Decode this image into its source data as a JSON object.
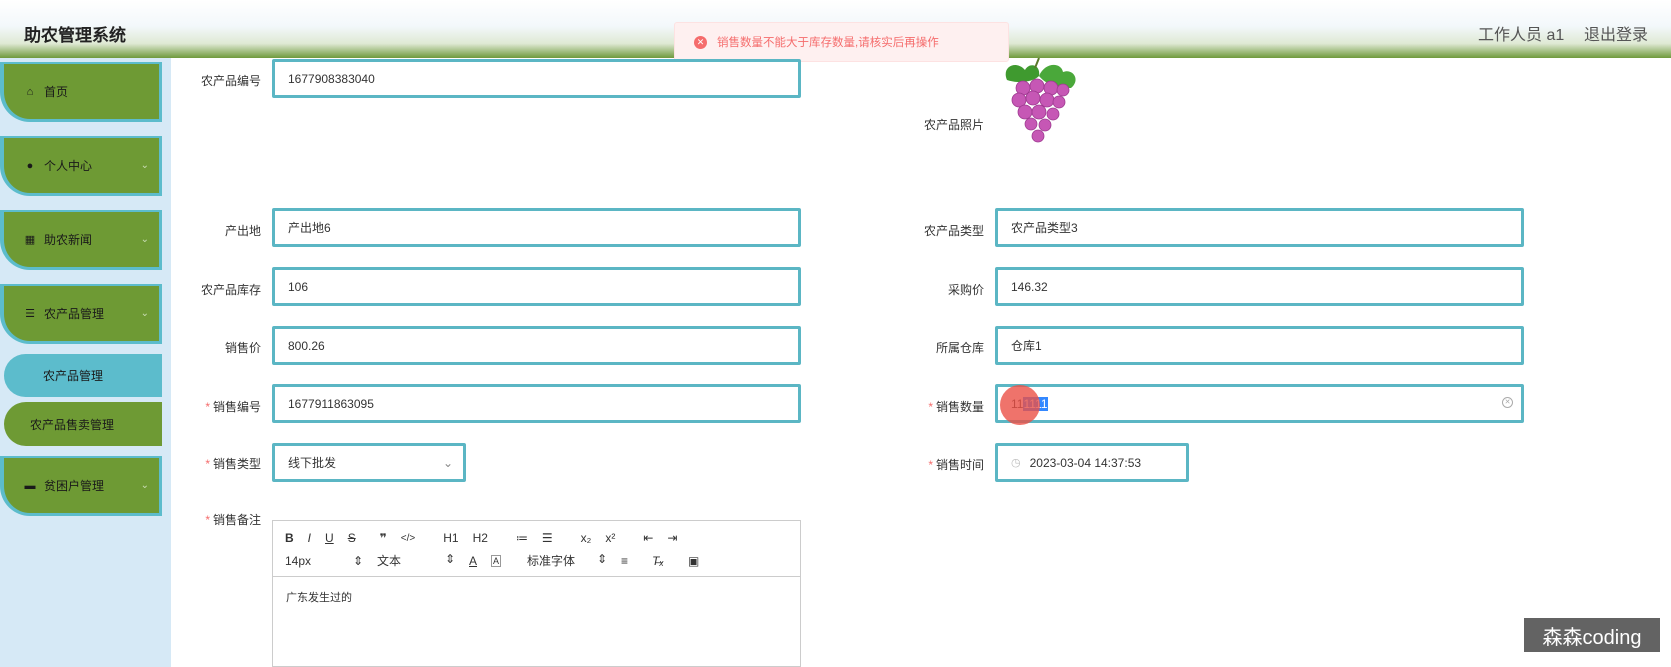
{
  "header": {
    "app_title": "助农管理系统",
    "user_label": "工作人员 a1",
    "logout_label": "退出登录"
  },
  "toast": {
    "message": "销售数量不能大于库存数量,请核实后再操作",
    "type": "error"
  },
  "sidebar": {
    "items": [
      {
        "label": "首页",
        "icon": "home-icon"
      },
      {
        "label": "个人中心",
        "icon": "user-icon"
      },
      {
        "label": "助农新闻",
        "icon": "grid-icon"
      },
      {
        "label": "农产品管理",
        "icon": "list-icon"
      },
      {
        "label": "贫困户管理",
        "icon": "monitor-icon"
      }
    ],
    "sub_items": [
      {
        "label": "农产品管理",
        "active": true
      },
      {
        "label": "农产品售卖管理",
        "active": false
      }
    ]
  },
  "form": {
    "product_no": {
      "label": "农产品编号",
      "value": "1677908383040"
    },
    "photo": {
      "label": "农产品照片",
      "image": "grape-image"
    },
    "origin": {
      "label": "产出地",
      "value": "产出地6"
    },
    "product_type": {
      "label": "农产品类型",
      "value": "农产品类型3"
    },
    "stock": {
      "label": "农产品库存",
      "value": "106"
    },
    "purchase_price": {
      "label": "采购价",
      "value": "146.32"
    },
    "sale_price": {
      "label": "销售价",
      "value": "800.26"
    },
    "warehouse": {
      "label": "所属仓库",
      "value": "仓库1"
    },
    "sale_no": {
      "label": "销售编号",
      "value": "1677911863095",
      "required": true
    },
    "sale_qty": {
      "label": "销售数量",
      "value_plain": "11",
      "value_selected": "1111",
      "required": true
    },
    "sale_type": {
      "label": "销售类型",
      "value": "线下批发",
      "required": true
    },
    "sale_time": {
      "label": "销售时间",
      "value": "2023-03-04 14:37:53",
      "required": true
    },
    "sale_note": {
      "label": "销售备注",
      "required": true
    }
  },
  "editor": {
    "toolbar_row1": [
      "B",
      "I",
      "U",
      "S",
      "❞",
      "</>",
      "H1",
      "H2",
      "≔",
      "☰",
      "x₂",
      "x²",
      "⇤",
      "⇥"
    ],
    "font_size": "14px",
    "text_style": "文本",
    "font_family": "标准字体",
    "content": "广东发生过的"
  },
  "watermark": "森森coding",
  "colors": {
    "accent_border": "#5bb6c4",
    "menu_green": "#6e9a34",
    "sidebar_bg": "#d6e9f6",
    "error": "#f56c6c"
  }
}
